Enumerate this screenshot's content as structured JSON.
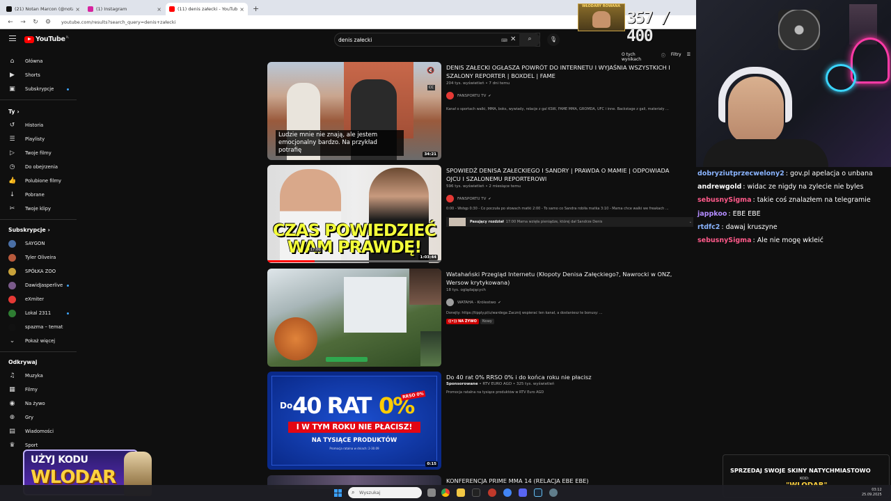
{
  "browser": {
    "tabs": [
      {
        "label": "(21) Notan Marcon (@notann…",
        "color": "#111111",
        "active": false
      },
      {
        "label": "(1) Instagram",
        "color": "#d6249f",
        "active": false
      },
      {
        "label": "(11) denis załecki - YouTube",
        "color": "#ff0000",
        "active": true
      }
    ],
    "new_tab": "+",
    "url": "youtube.com/results?search_query=denis+załecki"
  },
  "youtube": {
    "logo_text": "YouTube",
    "logo_region": "PL",
    "search_query": "denis załecki",
    "sort_bar": {
      "about": "O tych wynikach",
      "filters": "Filtry"
    },
    "sidebar": {
      "main": [
        {
          "label": "Główna",
          "icon": "home-icon",
          "glyph": "⌂",
          "dot": false
        },
        {
          "label": "Shorts",
          "icon": "shorts-icon",
          "glyph": "▶",
          "dot": false
        },
        {
          "label": "Subskrypcje",
          "icon": "subscriptions-icon",
          "glyph": "▣",
          "dot": true
        }
      ],
      "you_header": "Ty",
      "you": [
        {
          "label": "Historia",
          "icon": "history-icon",
          "glyph": "↺"
        },
        {
          "label": "Playlisty",
          "icon": "playlists-icon",
          "glyph": "☰"
        },
        {
          "label": "Twoje filmy",
          "icon": "your-videos-icon",
          "glyph": "▷"
        },
        {
          "label": "Do obejrzenia",
          "icon": "watch-later-icon",
          "glyph": "◷"
        },
        {
          "label": "Polubione filmy",
          "icon": "liked-icon",
          "glyph": "👍"
        },
        {
          "label": "Pobrane",
          "icon": "download-icon",
          "glyph": "↓"
        },
        {
          "label": "Twoje klipy",
          "icon": "clips-icon",
          "glyph": "✂"
        }
      ],
      "subs_header": "Subskrypcje",
      "subscriptions": [
        {
          "label": "SAYGON",
          "color": "#4a6fa5",
          "dot": false
        },
        {
          "label": "Tyler Oliveira",
          "color": "#b85a3c",
          "dot": false
        },
        {
          "label": "SPÓŁKA ZOO",
          "color": "#c8a23a",
          "dot": false
        },
        {
          "label": "DawidJasperlive",
          "color": "#7a5a8a",
          "dot": true
        },
        {
          "label": "eXmiter",
          "color": "#e53935",
          "dot": false
        },
        {
          "label": "Lokal 2311",
          "color": "#2e7d32",
          "dot": true
        },
        {
          "label": "spazma – temat",
          "color": "#111111",
          "dot": false
        }
      ],
      "show_more": "Pokaż więcej",
      "explore_header": "Odkrywaj",
      "explore": [
        {
          "label": "Muzyka",
          "icon": "music-icon",
          "glyph": "♫"
        },
        {
          "label": "Filmy",
          "icon": "movies-icon",
          "glyph": "▦"
        },
        {
          "label": "Na żywo",
          "icon": "live-icon",
          "glyph": "◉"
        },
        {
          "label": "Gry",
          "icon": "gaming-icon",
          "glyph": "⊕"
        },
        {
          "label": "Wiadomości",
          "icon": "news-icon",
          "glyph": "▤"
        },
        {
          "label": "Sport",
          "icon": "sport-icon",
          "glyph": "♛"
        }
      ]
    },
    "videos": [
      {
        "title": "DENIS ZAŁECKI OGŁASZA POWRÓT DO INTERNETU I WYJAŚNIA WSZYSTKICH I SZALONY REPORTER | BOXDEL | FAME",
        "meta": "204 tys. wyświetleń • 7 dni temu",
        "channel": "FANSPORTU TV",
        "channel_color": "#e53935",
        "desc": "Kanał o sportach walki, MMA, boks, wywiady, relacje z gal KSW, FAME MMA, GROMDA, UFC i inne. Backstage z gali, materiały ...",
        "duration": "34:21",
        "caption": "Ludzie mnie nie znają, ale jestem emocjonalny bardzo. Na przykład potrafię"
      },
      {
        "title": "SPOWIEDŹ DENISA ZAŁECKIEGO I SANDRY | PRAWDA O MAMIE | ODPOWIADA OJCU I SZALONEMU REPORTEROWI",
        "meta": "596 tys. wyświetleń • 2 miesiące temu",
        "channel": "FANSPORTU TV",
        "channel_color": "#e53935",
        "desc": "0:00 - Wstęp 0:30 - Co poczuła po słowach matki 2:00 - To samo co Sandra robiła matka 3:10 - Mama chce walki we freakach ...",
        "chapter_label": "Pasujący rozdział",
        "chapter_text": "17:00 Mama wzięła pieniądze, której dał Sandrze Denis",
        "duration": "1:03:44",
        "overlay_line1": "CZAS POWIEDZIEĆ",
        "overlay_line2": "WAM PRAWDĘ!",
        "hover_time": "17:00"
      },
      {
        "title": "Watahański Przegląd Internetu (Kłopoty Denisa Załęckiego?, Nawrocki w ONZ, Wersow krytykowana)",
        "meta": "18 tys. oglądających",
        "channel": "WATAHA - Królestwo",
        "channel_color": "#9e9e9e",
        "desc": "Donejty: https://tipply.pl/u/wardega Zacznij wspierać ten kanał, a dostaniesz te bonusy: ...",
        "live_badge": "NA ŻYWO",
        "new_badge": "Nowy"
      },
      {
        "title": "Do 40 rat 0% RRSO 0% i do końca roku nie płacisz",
        "sponsor": "Sponsorowane",
        "meta": " • RTV EURO AGD • 325 tys. wyświetleń",
        "desc": "Promocja ratalna na tysiące produktów w RTV Euro AGD",
        "duration": "0:15",
        "ad_pre": "Do",
        "ad_big": "40 RAT",
        "ad_pct": "0%",
        "ad_rrso": "RRSO 0%",
        "ad_banner": "I W TYM ROKU NIE PŁACISZ!",
        "ad_sub": "NA TYSIĄCE PRODUKTÓW",
        "ad_fine": "Promocja ratalna w dniach: 2-30.09"
      },
      {
        "title": "KONFERENCJA PRIME MMA 14 (RELACJA EBE EBE)"
      }
    ]
  },
  "stream": {
    "counter_title": "WŁODARY ROWANA",
    "counter": "357 / 400",
    "chat": [
      {
        "user": "dobryziutprzecwelony2",
        "text": "gov.pl apelacja o unbana",
        "color": "#8ab4ff"
      },
      {
        "user": "andrewgold",
        "text": "widac ze nigdy na zylecie nie byles",
        "color": "#ffffff"
      },
      {
        "user": "sebusnySigma",
        "text": "takie coś znalazłem na telegramie",
        "color": "#ff5a8a"
      },
      {
        "user": "jappkoo",
        "text": "EBE EBE",
        "color": "#b38cff"
      },
      {
        "user": "rtdfc2",
        "text": "dawaj kruszyne",
        "color": "#8ab4ff"
      },
      {
        "user": "sebusnySigma",
        "text": "Ale nie mogę wkleić",
        "color": "#ff5a8a"
      }
    ],
    "promo_line1": "UŻYJ KODU",
    "promo_line2": "WLODAR",
    "sell_line1": "SPRZEDAJ SWOJE SKINY NATYCHMIASTOWO",
    "sell_code_label": "KOD:",
    "sell_code": "\"WLODAR\""
  },
  "taskbar": {
    "search_placeholder": "Wyszukaj",
    "time": "03:12",
    "date": "25.09.2025"
  }
}
